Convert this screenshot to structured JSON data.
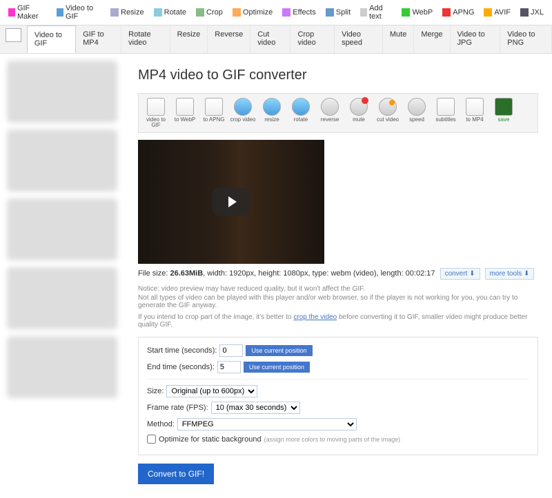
{
  "topnav": [
    {
      "label": "GIF Maker",
      "icon": "gif"
    },
    {
      "label": "Video to GIF",
      "icon": "video"
    },
    {
      "label": "Resize",
      "icon": "resize"
    },
    {
      "label": "Rotate",
      "icon": "rotate"
    },
    {
      "label": "Crop",
      "icon": "crop"
    },
    {
      "label": "Optimize",
      "icon": "optimize"
    },
    {
      "label": "Effects",
      "icon": "effects"
    },
    {
      "label": "Split",
      "icon": "split"
    },
    {
      "label": "Add text",
      "icon": "text"
    },
    {
      "label": "WebP",
      "icon": "webp"
    },
    {
      "label": "APNG",
      "icon": "apng"
    },
    {
      "label": "AVIF",
      "icon": "avif"
    },
    {
      "label": "JXL",
      "icon": "jxl"
    }
  ],
  "subnav": [
    "Video to GIF",
    "GIF to MP4",
    "Rotate video",
    "Resize",
    "Reverse",
    "Cut video",
    "Crop video",
    "Video speed",
    "Mute",
    "Merge",
    "Video to JPG",
    "Video to PNG"
  ],
  "subnav_active": 0,
  "title": "MP4 video to GIF converter",
  "tools": [
    {
      "label": "video to GIF",
      "cls": "film"
    },
    {
      "label": "to WebP",
      "cls": "film"
    },
    {
      "label": "to APNG",
      "cls": "film"
    },
    {
      "label": "crop video",
      "cls": "blue"
    },
    {
      "label": "resize",
      "cls": "blue"
    },
    {
      "label": "rotate",
      "cls": "blue"
    },
    {
      "label": "reverse",
      "cls": ""
    },
    {
      "label": "mute",
      "cls": "red"
    },
    {
      "label": "cut video",
      "cls": "orange"
    },
    {
      "label": "speed",
      "cls": ""
    },
    {
      "label": "subtitles",
      "cls": "film"
    },
    {
      "label": "to MP4",
      "cls": "film"
    },
    {
      "label": "save",
      "cls": "save",
      "green": true
    }
  ],
  "file": {
    "prefix": "File size: ",
    "size": "26.63MiB",
    "rest": ", width: 1920px, height: 1080px, type: webm (video), length: 00:02:17",
    "convert": "convert",
    "moretools": "more tools"
  },
  "notice1": "Notice: video preview may have reduced quality, but it won't affect the GIF.",
  "notice2": "Not all types of video can be played with this player and/or web browser, so if the player is not working for you, you can try to generate the GIF anyway.",
  "notice3_a": "If you intend to crop part of the image, it's better to ",
  "notice3_link": "crop the video",
  "notice3_b": " before converting it to GIF, smaller video might produce better quality GIF.",
  "form": {
    "start_label": "Start time (seconds):",
    "start_value": "0",
    "end_label": "End time (seconds):",
    "end_value": "5",
    "use_current": "Use current position",
    "size_label": "Size:",
    "size_value": "Original (up to 600px)",
    "fps_label": "Frame rate (FPS):",
    "fps_value": "10 (max 30 seconds)",
    "method_label": "Method:",
    "method_value": "FFMPEG",
    "optimize_label": "Optimize for static background",
    "optimize_hint": "(assign more colors to moving parts of the image)"
  },
  "convert_btn": "Convert to GIF!"
}
